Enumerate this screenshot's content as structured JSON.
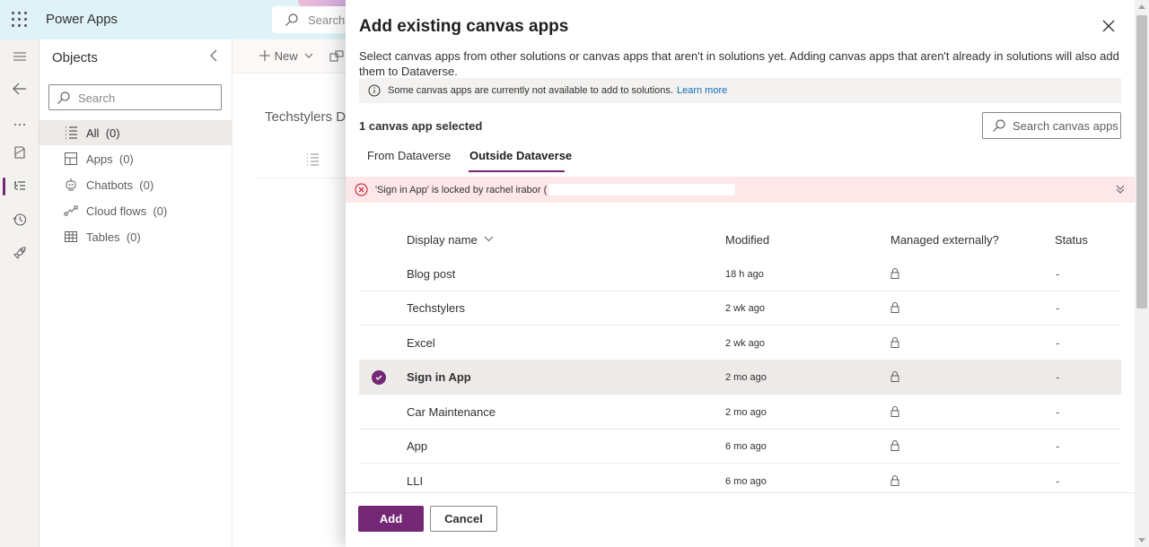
{
  "app": {
    "brand": "Power Apps",
    "search_placeholder": "Search"
  },
  "rail": {
    "icons": [
      "menu-icon",
      "back-arrow-icon",
      "more-icon",
      "book-icon",
      "tree-view-icon",
      "history-icon",
      "rocket-icon"
    ]
  },
  "objects": {
    "title": "Objects",
    "search_placeholder": "Search",
    "items": [
      {
        "label": "All",
        "count": "(0)",
        "icon": "list-icon"
      },
      {
        "label": "Apps",
        "count": "(0)",
        "icon": "apps-icon"
      },
      {
        "label": "Chatbots",
        "count": "(0)",
        "icon": "chatbot-icon"
      },
      {
        "label": "Cloud flows",
        "count": "(0)",
        "icon": "flow-icon"
      },
      {
        "label": "Tables",
        "count": "(0)",
        "icon": "table-icon"
      }
    ]
  },
  "background": {
    "new_label": "New",
    "solution_title": "Techstylers D"
  },
  "panel": {
    "title": "Add existing canvas apps",
    "description": "Select canvas apps from other solutions or canvas apps that aren't in solutions yet. Adding canvas apps that aren't already in solutions will also add them to Dataverse.",
    "info_text": "Some canvas apps are currently not available to add to solutions.",
    "info_link": "Learn more",
    "selected_count": "1 canvas app selected",
    "search_placeholder": "Search canvas apps",
    "tabs": [
      {
        "label": "From Dataverse",
        "active": false
      },
      {
        "label": "Outside Dataverse",
        "active": true
      }
    ],
    "error_text": "'Sign in App' is locked by rachel irabor (",
    "columns": {
      "display_name": "Display name",
      "modified": "Modified",
      "managed": "Managed externally?",
      "status": "Status"
    },
    "rows": [
      {
        "name": "Blog post",
        "modified": "18 h ago",
        "status": "-",
        "selected": false
      },
      {
        "name": "Techstylers",
        "modified": "2 wk ago",
        "status": "-",
        "selected": false
      },
      {
        "name": "Excel",
        "modified": "2 wk ago",
        "status": "-",
        "selected": false
      },
      {
        "name": "Sign in App",
        "modified": "2 mo ago",
        "status": "-",
        "selected": true
      },
      {
        "name": "Car Maintenance",
        "modified": "2 mo ago",
        "status": "-",
        "selected": false
      },
      {
        "name": "App",
        "modified": "6 mo ago",
        "status": "-",
        "selected": false
      },
      {
        "name": "LLI",
        "modified": "6 mo ago",
        "status": "-",
        "selected": false
      }
    ],
    "add_label": "Add",
    "cancel_label": "Cancel"
  },
  "colors": {
    "accent": "#742774",
    "topbar": "#dff2f7",
    "error_bg": "#fde7e9",
    "error_icon": "#c50f1f"
  }
}
